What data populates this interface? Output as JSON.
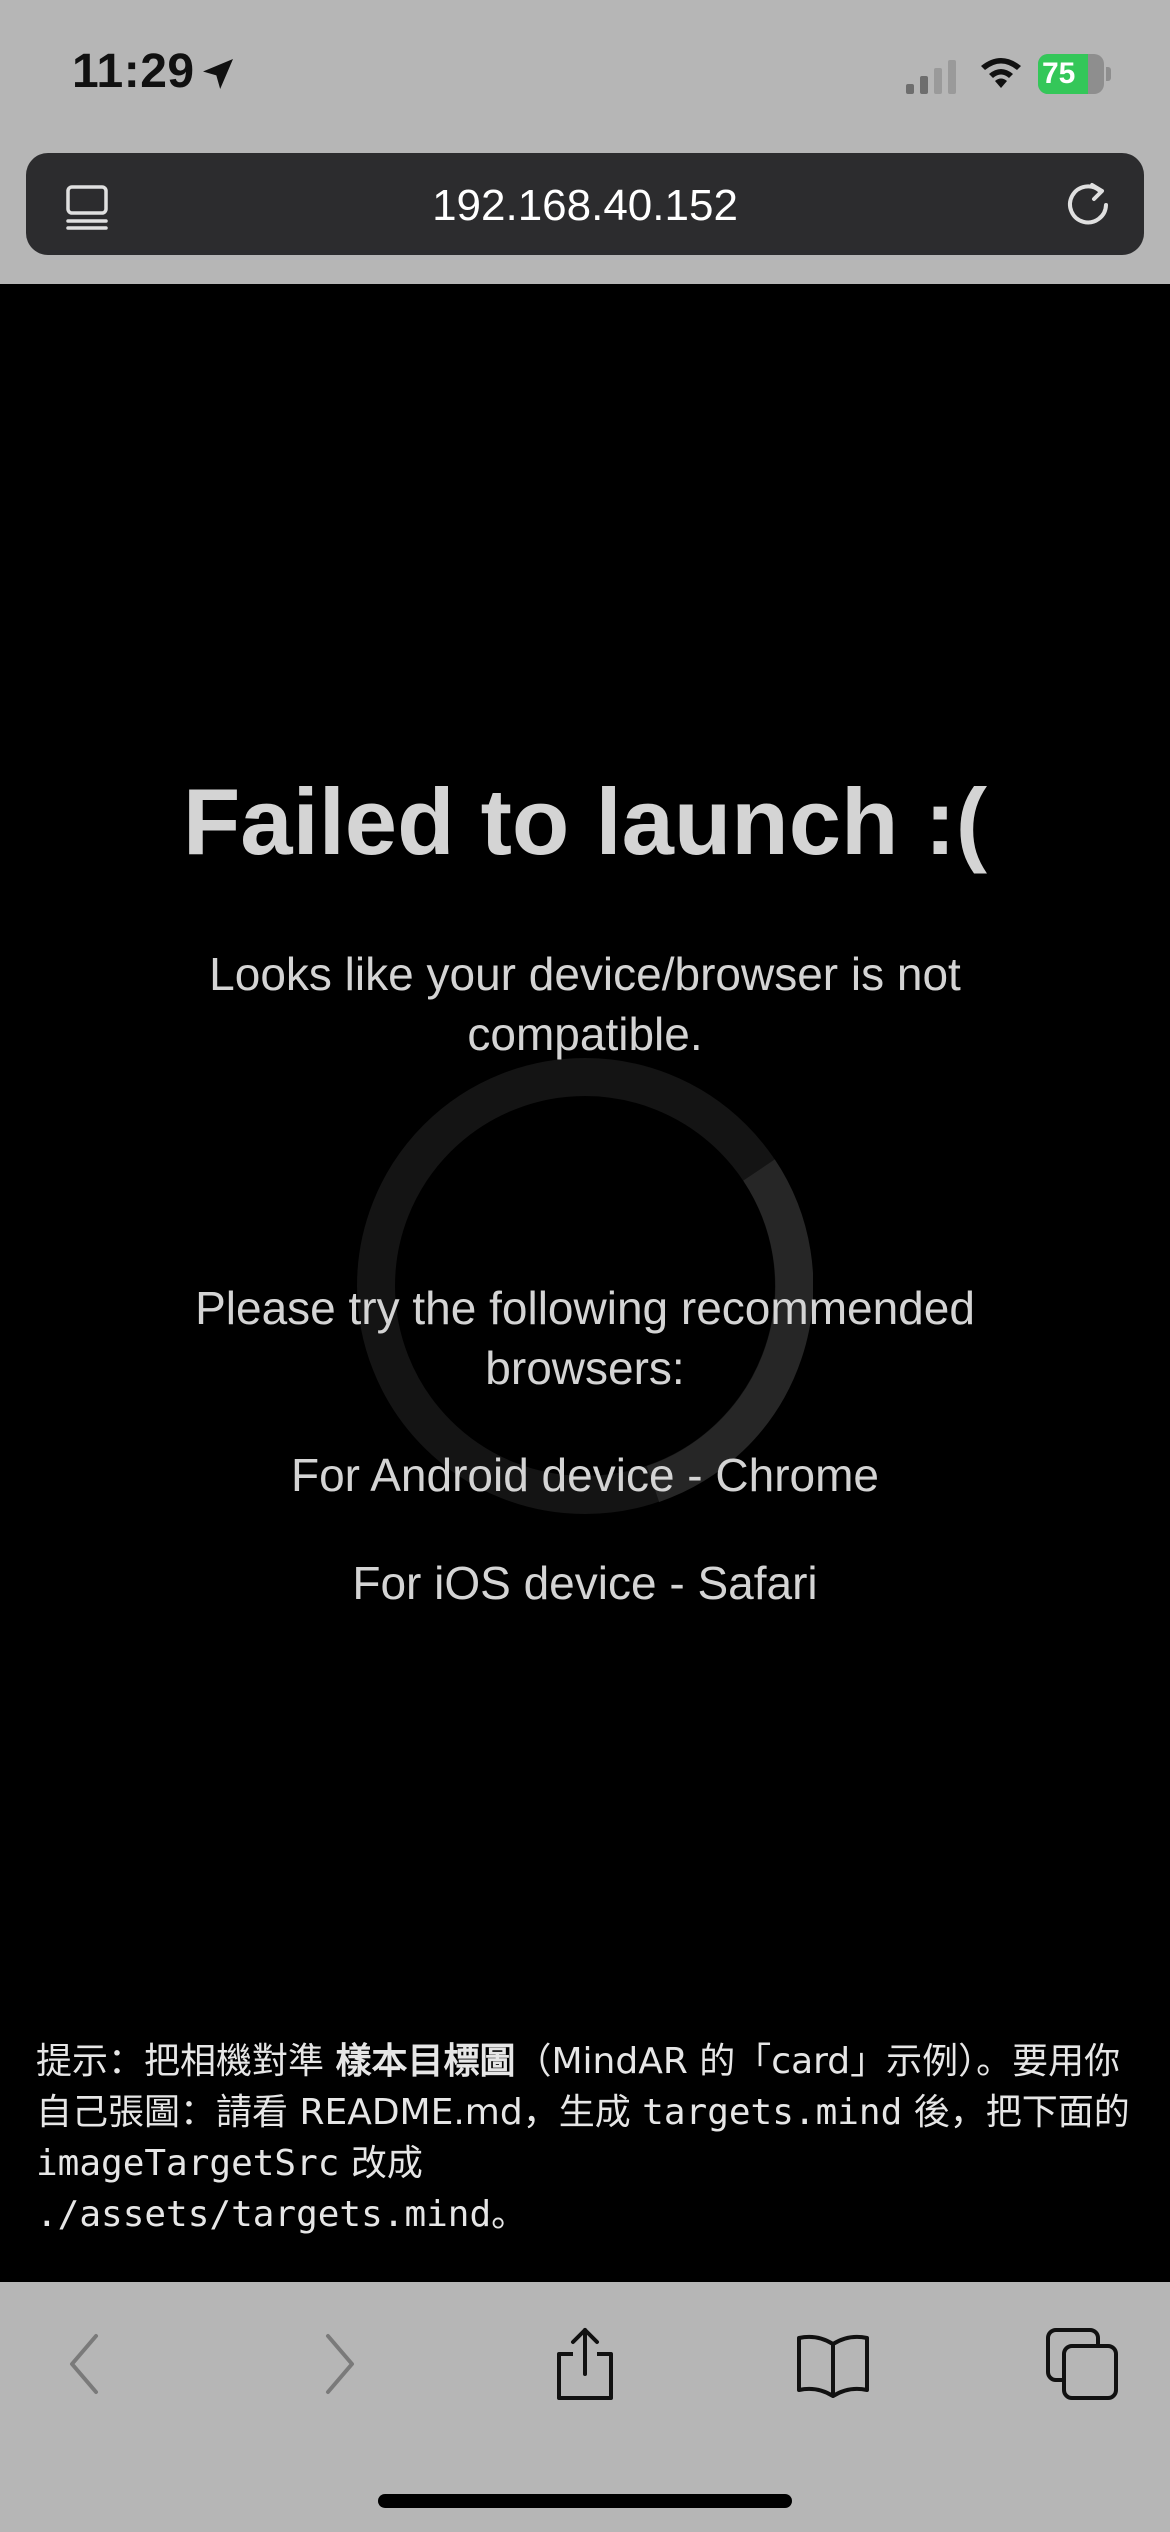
{
  "status_bar": {
    "time": "11:29",
    "battery_level": "75",
    "battery_fraction": 0.75,
    "battery_color": "#34c759"
  },
  "address_bar": {
    "url": "192.168.40.152"
  },
  "error": {
    "title": "Failed to launch :(",
    "message": "Looks like your device/browser is not compatible.",
    "recommend_intro": "Please try the following recommended browsers:",
    "android": "For Android device - Chrome",
    "ios": "For iOS device - Safari"
  },
  "hint": {
    "prefix": "提示：把相機對準 ",
    "bold_target": "樣本目標圖",
    "mid1": "（MindAR 的「card」示例）。要用你自己張圖：請看 README.md，生成 ",
    "code_targets": "targets.mind",
    "mid2": " 後，把下面的 ",
    "code_src": "imageTargetSrc",
    "mid3": " 改成 ",
    "code_path": "./assets/targets.mind",
    "suffix": "。"
  },
  "icons": {
    "location": "location-arrow-icon",
    "signal": "cellular-signal-icon",
    "wifi": "wifi-icon",
    "tabs_overview": "tab-overview-icon",
    "reload": "reload-icon",
    "back": "chevron-left-icon",
    "forward": "chevron-right-icon",
    "share": "share-icon",
    "bookmarks": "book-icon",
    "tabs": "tabs-icon"
  },
  "colors": {
    "chrome_bg": "#b6b6b6",
    "address_bg": "#2c2c2e",
    "content_bg": "#000000",
    "text_light": "#d4d4d4"
  }
}
